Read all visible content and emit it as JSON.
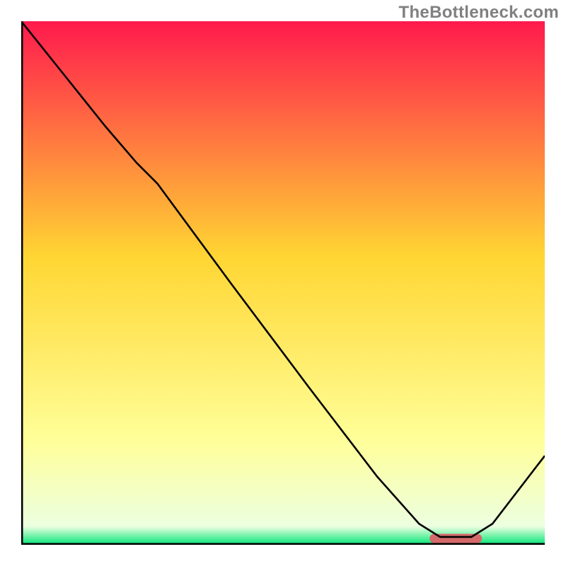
{
  "watermark": "TheBottleneck.com",
  "chart_data": {
    "type": "line",
    "title": "",
    "xlabel": "",
    "ylabel": "",
    "xlim": [
      0,
      1
    ],
    "ylim": [
      0,
      1
    ],
    "series": [
      {
        "name": "curve",
        "x": [
          0.0,
          0.08,
          0.16,
          0.22,
          0.26,
          0.4,
          0.55,
          0.68,
          0.76,
          0.8,
          0.86,
          0.9,
          1.0
        ],
        "y": [
          1.0,
          0.9,
          0.8,
          0.73,
          0.69,
          0.5,
          0.3,
          0.13,
          0.04,
          0.015,
          0.015,
          0.04,
          0.17
        ],
        "stroke": "#000000",
        "stroke_width": 2.6
      }
    ],
    "marker": {
      "x0": 0.78,
      "x1": 0.88,
      "y": 0.012,
      "height": 0.018,
      "fill": "#d46a6a"
    },
    "axes": {
      "stroke": "#000000",
      "stroke_width": 5
    },
    "background_gradient": {
      "top": "#ff1a4d",
      "mid": "#ffd633",
      "green": "#00e676",
      "pale_top": 0.8,
      "pale_bottom": 0.965
    }
  }
}
